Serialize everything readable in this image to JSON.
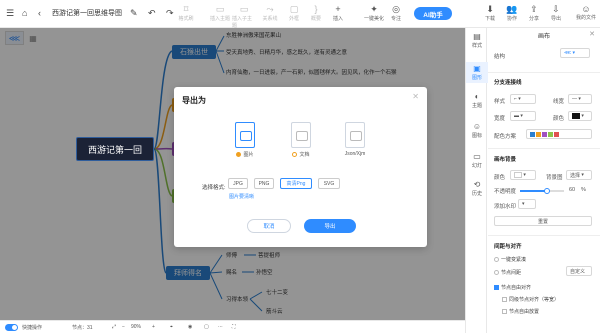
{
  "document": {
    "title": "西游记第一回思维导图"
  },
  "toolbar": {
    "left_items": [
      {
        "label": "格式刷"
      },
      {
        "label": "插入主题"
      },
      {
        "label": "插入子主题"
      },
      {
        "label": "关系线"
      },
      {
        "label": "外框"
      },
      {
        "label": "概要"
      },
      {
        "label": "插入"
      },
      {
        "label": "一键美化"
      },
      {
        "label": "专注"
      }
    ],
    "ai_label": "AI助手",
    "right_items": [
      {
        "label": "下载"
      },
      {
        "label": "协作"
      },
      {
        "label": "分享"
      },
      {
        "label": "导出"
      }
    ],
    "account_label": "我的文件"
  },
  "mindmap": {
    "root": "西游记第一回",
    "branch_top": "石猴出世",
    "branch_top_leaves": [
      "东胜神洲傲来国花果山",
      "受天真地秀、日精月华，感之既久，遂有灵通之意",
      "内育仙胞，一日迸裂，产一石卵，似圆毬样大。因见风，化作一个石猴"
    ],
    "branch_bottom": "拜师得名",
    "branch_bottom_leaves": [
      "师傅",
      "菩提祖师",
      "赐名",
      "孙悟空",
      "习得本领",
      "七十二变",
      "筋斗云"
    ]
  },
  "dialog": {
    "title": "导出为",
    "formats": [
      {
        "label": "图片"
      },
      {
        "label": "文档"
      },
      {
        "label": "Json/Xjm"
      }
    ],
    "select_label": "选择格式:",
    "options": [
      "JPG",
      "PNG",
      "高清Png",
      "SVG"
    ],
    "link": "图片要清晰",
    "cancel": "取消",
    "confirm": "导出"
  },
  "right_strip": [
    {
      "label": "样式"
    },
    {
      "label": "图形"
    },
    {
      "label": "主题"
    },
    {
      "label": "图标"
    },
    {
      "label": "幻灯"
    },
    {
      "label": "历史"
    }
  ],
  "panel": {
    "title": "画布",
    "structure_label": "结构",
    "section_branch": "分支连接线",
    "style_label": "样式",
    "width_label": "线宽",
    "taper_label": "宽度",
    "color_label": "颜色",
    "palette_label": "配色方案",
    "section_bg": "画布背景",
    "bg_color_label": "颜色",
    "bg_image_label": "背景图",
    "bg_image_value": "选择",
    "opacity_label": "不透明度",
    "opacity_value": "60",
    "opacity_unit": "%",
    "watermark_label": "添加水印",
    "reset_label": "重置",
    "section_layout": "间距与对齐",
    "compact_label": "一键变紧凑",
    "node_spacing_label": "节点间距",
    "custom_label": "自定义",
    "check1": "节点自由对齐",
    "check2": "同级节点对齐（等宽）",
    "check3": "节点自由放置",
    "accent": "#2f8cff"
  },
  "status": {
    "quick_label": "快捷操作",
    "node_count": "节点：31",
    "zoom": "90%"
  }
}
